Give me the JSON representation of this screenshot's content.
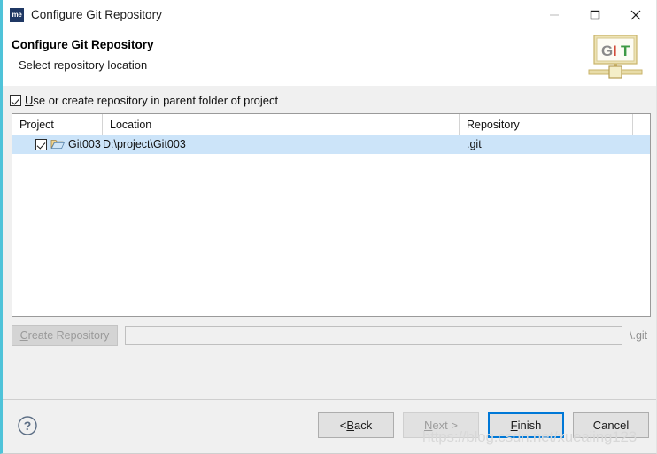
{
  "window": {
    "title": "Configure Git Repository",
    "icon_label": "me",
    "controls": {
      "minimize": "minimize-icon",
      "maximize": "maximize-icon",
      "close": "close-icon"
    }
  },
  "header": {
    "title": "Configure Git Repository",
    "subtitle": "Select repository location",
    "logo_letters": [
      "G",
      "I",
      "T"
    ],
    "logo_colors": [
      "#8a8a8a",
      "#d24b3a",
      "#3f9a45"
    ]
  },
  "options": {
    "parent_folder_checkbox": {
      "label_prefix": "",
      "mnemonic": "U",
      "label_rest": "se or create repository in parent folder of project",
      "checked": true
    }
  },
  "table": {
    "columns": [
      "Project",
      "Location",
      "Repository",
      ""
    ],
    "rows": [
      {
        "checked": true,
        "project": "Git003",
        "location": "D:\\project\\Git003",
        "repository": ".git",
        "extra": "",
        "selected": true
      }
    ]
  },
  "create_repository": {
    "button_mnemonic": "C",
    "button_label_rest": "reate Repository",
    "button_enabled": false,
    "path_value": "",
    "path_placeholder": "",
    "suffix": "\\.git"
  },
  "footer": {
    "help_icon": "help-icon",
    "buttons": [
      {
        "name": "back",
        "prefix": "< ",
        "mnemonic": "B",
        "rest": "ack",
        "enabled": true,
        "default": false
      },
      {
        "name": "next",
        "prefix": "",
        "mnemonic": "N",
        "rest": "ext >",
        "enabled": false,
        "default": false
      },
      {
        "name": "finish",
        "prefix": "",
        "mnemonic": "F",
        "rest": "inish",
        "enabled": true,
        "default": true
      },
      {
        "name": "cancel",
        "prefix": "",
        "mnemonic": "",
        "rest": "Cancel",
        "enabled": true,
        "default": false
      }
    ]
  },
  "watermark": "https://blog.csdn.net/xueaiing123",
  "colors": {
    "accent_border": "#4fc3d9",
    "selection": "#cce4f9",
    "default_button_border": "#0078d7",
    "title_icon_bg": "#1f3864"
  }
}
